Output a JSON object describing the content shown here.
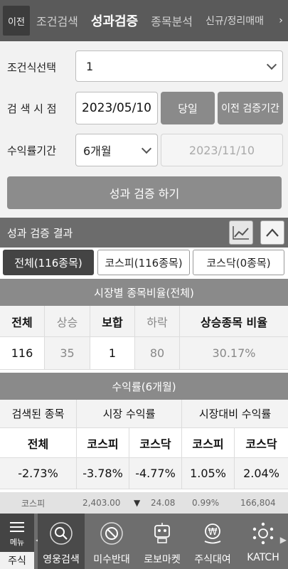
{
  "topbar": {
    "prev_label": "이전",
    "tabs": [
      "조건검색",
      "성과검증",
      "종목분석",
      "신규/정리매매"
    ],
    "active_tab": "성과검증"
  },
  "form": {
    "condition_label": "조건식선택",
    "condition_value": "1",
    "search_point_label": "검 색 시 점",
    "search_date": "2023/05/10",
    "today_button": "당일",
    "prev_period_button": "이전 검증기간",
    "return_period_label": "수익률기간",
    "return_period_value": "6개월",
    "end_date": "2023/11/10",
    "run_button": "성과 검증 하기"
  },
  "results": {
    "title": "성과 검증 결과",
    "segments": [
      "전체(116종목)",
      "코스피(116종목)",
      "코스닥(0종목)"
    ],
    "market_ratio": {
      "title": "시장별 종목비율(전체)",
      "headers": [
        "전체",
        "상승",
        "보합",
        "하락",
        "상승종목 비율"
      ],
      "values": [
        "116",
        "35",
        "1",
        "80",
        "30.17%"
      ]
    },
    "returns": {
      "title": "수익률(6개월)",
      "group_headers": [
        "검색된 종목",
        "시장 수익률",
        "시장대비 수익률"
      ],
      "sub_headers": [
        "전체",
        "코스피",
        "코스닥",
        "코스피",
        "코스닥"
      ],
      "values": [
        "-2.73%",
        "-3.78%",
        "-4.77%",
        "1.05%",
        "2.04%"
      ]
    }
  },
  "ticker": {
    "name": "코스피",
    "price": "2,403.00",
    "direction": "▼",
    "change": "24.08",
    "rate": "0.99%",
    "volume": "166,804"
  },
  "bottomnav": {
    "menu_label": "메뉴",
    "stock_label": "주식",
    "items": [
      {
        "label": "영웅검색",
        "icon": "magnifier-icon"
      },
      {
        "label": "미수반대",
        "icon": "prohibited-icon"
      },
      {
        "label": "로보마켓",
        "icon": "robot-icon"
      },
      {
        "label": "주식대여",
        "icon": "won-lend-icon"
      },
      {
        "label": "KATCH",
        "icon": "network-icon"
      }
    ]
  }
}
